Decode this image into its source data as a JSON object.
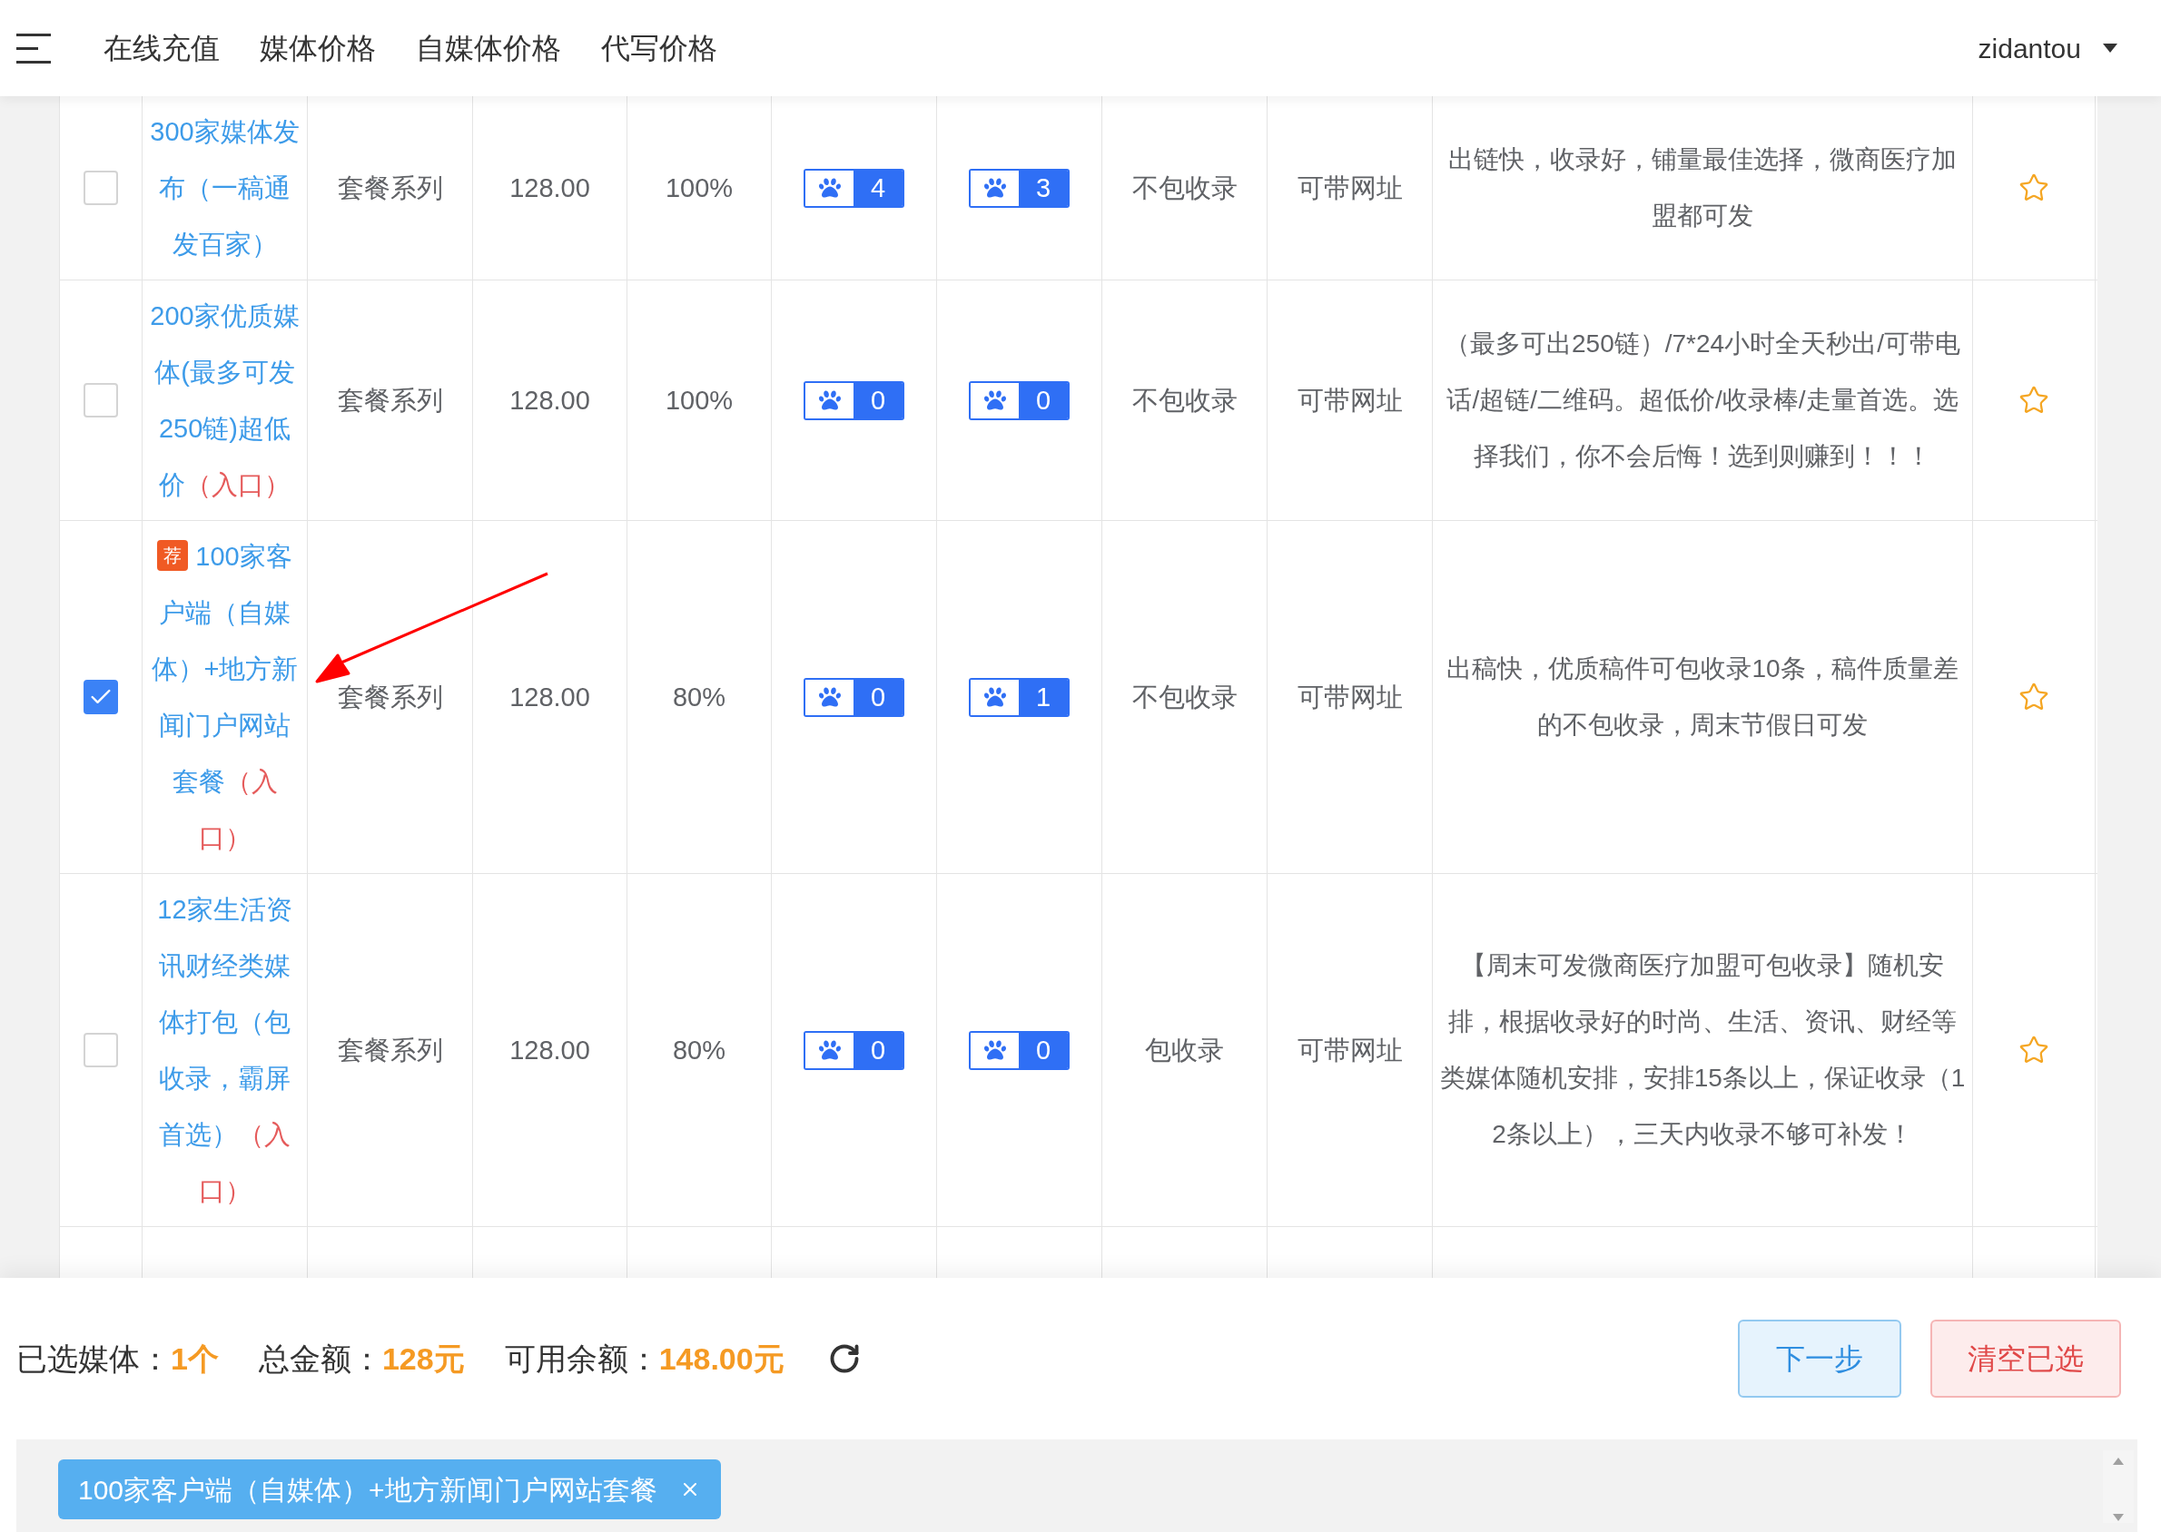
{
  "nav": {
    "items": [
      "在线充值",
      "媒体价格",
      "自媒体价格",
      "代写价格"
    ],
    "user": "zidantou"
  },
  "rows": [
    {
      "selected": false,
      "name": "300家媒体发布（一稿通发百家）",
      "entry": "",
      "category": "套餐系列",
      "price": "128.00",
      "percent": "100%",
      "paw_badges": [
        "4",
        "3"
      ],
      "inclusion": "不包收录",
      "link": "可带网址",
      "description": "出链快，收录好，铺量最佳选择，微商医疗加盟都可发",
      "favorited": false
    },
    {
      "selected": false,
      "name": "200家优质媒体(最多可发250链)超低价",
      "entry": "（入口）",
      "category": "套餐系列",
      "price": "128.00",
      "percent": "100%",
      "paw_badges": [
        "0",
        "0"
      ],
      "inclusion": "不包收录",
      "link": "可带网址",
      "description": "（最多可出250链）/7*24小时全天秒出/可带电话/超链/二维码。超低价/收录棒/走量首选。选择我们，你不会后悔！选到则赚到！！！",
      "favorited": false
    },
    {
      "selected": true,
      "badge": "荐",
      "name": "100家客户端（自媒体）+地方新闻门户网站套餐",
      "entry": "（入口）",
      "category": "套餐系列",
      "price": "128.00",
      "percent": "80%",
      "paw_badges": [
        "0",
        "1"
      ],
      "inclusion": "不包收录",
      "link": "可带网址",
      "description": "出稿快，优质稿件可包收录10条，稿件质量差的不包收录，周末节假日可发",
      "favorited": false
    },
    {
      "selected": false,
      "name": "12家生活资讯财经类媒体打包（包收录，霸屏首选）",
      "entry": "（入口）",
      "category": "套餐系列",
      "price": "128.00",
      "percent": "80%",
      "paw_badges": [
        "0",
        "0"
      ],
      "inclusion": "包收录",
      "link": "可带网址",
      "description": "【周末可发微商医疗加盟可包收录】随机安排，根据收录好的时尚、生活、资讯、财经等类媒体随机安排，安排15条以上，保证收录（12条以上），三天内收录不够可补发！",
      "favorited": false
    }
  ],
  "summary": [
    {
      "label": "已选媒体：",
      "value": "1个"
    },
    {
      "label": "总金额：",
      "value": "128元"
    },
    {
      "label": "可用余额：",
      "value": "148.00元"
    }
  ],
  "buttons": [
    {
      "label": "下一步",
      "kind": "primary"
    },
    {
      "label": "清空已选",
      "kind": "danger"
    }
  ],
  "chips": [
    "100家客户端（自媒体）+地方新闻门户网站套餐"
  ]
}
